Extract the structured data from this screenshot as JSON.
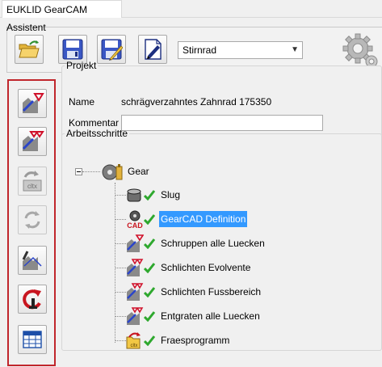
{
  "tab": {
    "label": "EUKLID GearCAM Assistent"
  },
  "toolbar": {
    "buttons": [
      {
        "name": "open-button",
        "icon": "open-folder-icon"
      },
      {
        "name": "save-button",
        "icon": "floppy-disk-icon"
      },
      {
        "name": "save-as-button",
        "icon": "floppy-edit-icon"
      },
      {
        "name": "edit-document-button",
        "icon": "document-pen-icon"
      }
    ],
    "gear_type": {
      "selected": "Stirnrad"
    }
  },
  "sidebar": {
    "buttons": [
      {
        "name": "roughing-step-button",
        "icon": "gear-single-triangle-icon",
        "enabled": true
      },
      {
        "name": "finishing-step-button",
        "icon": "gear-double-triangle-icon",
        "enabled": true
      },
      {
        "name": "cltx-import-button",
        "icon": "cltx-arrow-icon",
        "enabled": false
      },
      {
        "name": "refresh-button",
        "icon": "refresh-icon",
        "enabled": false
      },
      {
        "name": "simulate-button",
        "icon": "tool-path-icon",
        "enabled": true
      },
      {
        "name": "reset-button",
        "icon": "undo-arrow-icon",
        "enabled": true
      },
      {
        "name": "table-view-button",
        "icon": "table-icon",
        "enabled": true
      }
    ]
  },
  "projekt": {
    "legend": "Projekt",
    "name_label": "Name",
    "name_value": "schrägverzahntes Zahnrad 175350",
    "kommentar_label": "Kommentar",
    "kommentar_value": ""
  },
  "arbeitsschritte": {
    "legend": "Arbeitsschritte",
    "root": {
      "label": "Gear",
      "icon": "gear-part-icon",
      "expanded": true
    },
    "children": [
      {
        "label": "Slug",
        "icon": "slug-icon",
        "status": "check",
        "selected": false
      },
      {
        "label": "GearCAD Definition",
        "icon": "cad-icon",
        "status": "check",
        "selected": true
      },
      {
        "label": "Schruppen alle Luecken",
        "icon": "gear-single-triangle-icon",
        "status": "check",
        "selected": false
      },
      {
        "label": "Schlichten Evolvente",
        "icon": "gear-double-triangle-icon",
        "status": "check",
        "selected": false
      },
      {
        "label": "Schlichten Fussbereich",
        "icon": "gear-double-triangle-icon",
        "status": "check",
        "selected": false
      },
      {
        "label": "Entgraten alle Luecken",
        "icon": "gear-double-triangle-icon",
        "status": "check",
        "selected": false
      },
      {
        "label": "Fraesprogramm",
        "icon": "cltx-folder-icon",
        "status": "check",
        "selected": false
      }
    ]
  },
  "colors": {
    "selection": "#3399ff",
    "highlight_border": "#c0262c",
    "check": "#2ea82e"
  }
}
